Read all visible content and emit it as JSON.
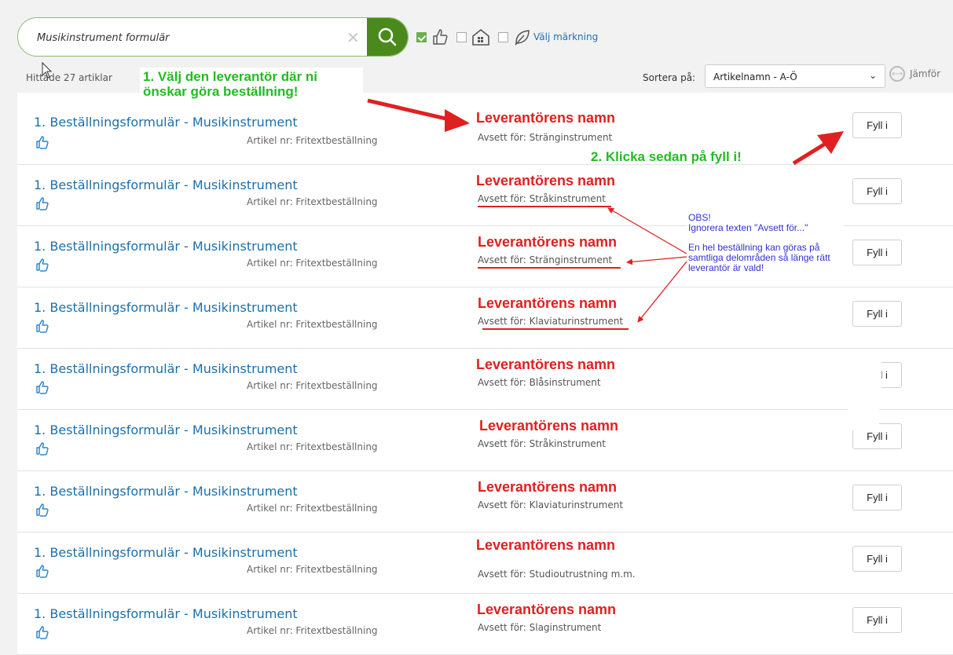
{
  "search": {
    "value": "Musikinstrument formulär",
    "clear_glyph": "✕"
  },
  "filters": {
    "favorites_checked": true,
    "label_link": "Välj märkning"
  },
  "results": {
    "found_text": "Hittade 27 artiklar",
    "sort_label": "Sortera på:",
    "sort_value": "Artikelnamn - A-Ö",
    "compare_label": "Jämför"
  },
  "items": [
    {
      "title": "1. Beställningsformulär - Musikinstrument",
      "article_nr": "Artikel nr: Fritextbeställning",
      "supplier": "Leverantörens namn",
      "intended_for": "Avsett för: Stränginstrument",
      "button": "Fyll i"
    },
    {
      "title": "1. Beställningsformulär - Musikinstrument",
      "article_nr": "Artikel nr: Fritextbeställning",
      "supplier": "Leverantörens namn",
      "intended_for": "Avsett för: Stråkinstrument",
      "button": "Fyll i"
    },
    {
      "title": "1. Beställningsformulär - Musikinstrument",
      "article_nr": "Artikel nr: Fritextbeställning",
      "supplier": "Leverantörens namn",
      "intended_for": "Avsett för: Stränginstrument",
      "button": "Fyll i"
    },
    {
      "title": "1. Beställningsformulär - Musikinstrument",
      "article_nr": "Artikel nr: Fritextbeställning",
      "supplier": "Leverantörens namn",
      "intended_for": "Avsett för: Klaviaturinstrument",
      "button": "Fyll i"
    },
    {
      "title": "1. Beställningsformulär - Musikinstrument",
      "article_nr": "Artikel nr: Fritextbeställning",
      "supplier": "Leverantörens namn",
      "intended_for": "Avsett för: Blåsinstrument",
      "button": "Fyll i"
    },
    {
      "title": "1. Beställningsformulär - Musikinstrument",
      "article_nr": "Artikel nr: Fritextbeställning",
      "supplier": "Leverantörens namn",
      "intended_for": "Avsett för: Stråkinstrument",
      "button": "Fyll i"
    },
    {
      "title": "1. Beställningsformulär - Musikinstrument",
      "article_nr": "Artikel nr: Fritextbeställning",
      "supplier": "Leverantörens namn",
      "intended_for": "Avsett för: Klaviaturinstrument",
      "button": "Fyll i"
    },
    {
      "title": "1. Beställningsformulär - Musikinstrument",
      "article_nr": "Artikel nr: Fritextbeställning",
      "supplier": "Leverantörens namn",
      "intended_for": "Avsett för: Studioutrustning m.m.",
      "button": "Fyll i"
    },
    {
      "title": "1. Beställningsformulär - Musikinstrument",
      "article_nr": "Artikel nr: Fritextbeställning",
      "supplier": "Leverantörens namn",
      "intended_for": "Avsett för: Slaginstrument",
      "button": "Fyll i"
    }
  ],
  "annotations": {
    "step1": "1. Välj den leverantör där ni önskar göra beställning!",
    "step2": "2. Klicka sedan på fyll i!",
    "obs_title": "OBS!",
    "obs_line1": "Ignorera texten \"Avsett för...\"",
    "obs_line2": "En hel beställning kan göras på samtliga delområden så länge rätt leverantör är vald!"
  },
  "colors": {
    "link_blue": "#1e6fa8",
    "search_green": "#4a8a1c",
    "annotation_red": "#e02020",
    "annotation_green": "#22bb22",
    "annotation_blue": "#3030d0"
  }
}
